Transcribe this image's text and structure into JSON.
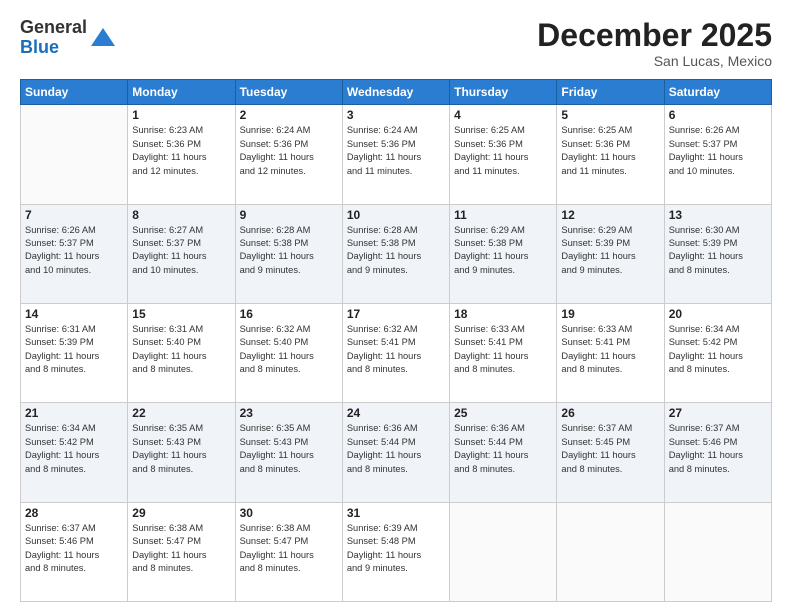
{
  "header": {
    "logo_general": "General",
    "logo_blue": "Blue",
    "month_title": "December 2025",
    "location": "San Lucas, Mexico"
  },
  "days_of_week": [
    "Sunday",
    "Monday",
    "Tuesday",
    "Wednesday",
    "Thursday",
    "Friday",
    "Saturday"
  ],
  "weeks": [
    [
      {
        "day": "",
        "info": ""
      },
      {
        "day": "1",
        "info": "Sunrise: 6:23 AM\nSunset: 5:36 PM\nDaylight: 11 hours\nand 12 minutes."
      },
      {
        "day": "2",
        "info": "Sunrise: 6:24 AM\nSunset: 5:36 PM\nDaylight: 11 hours\nand 12 minutes."
      },
      {
        "day": "3",
        "info": "Sunrise: 6:24 AM\nSunset: 5:36 PM\nDaylight: 11 hours\nand 11 minutes."
      },
      {
        "day": "4",
        "info": "Sunrise: 6:25 AM\nSunset: 5:36 PM\nDaylight: 11 hours\nand 11 minutes."
      },
      {
        "day": "5",
        "info": "Sunrise: 6:25 AM\nSunset: 5:36 PM\nDaylight: 11 hours\nand 11 minutes."
      },
      {
        "day": "6",
        "info": "Sunrise: 6:26 AM\nSunset: 5:37 PM\nDaylight: 11 hours\nand 10 minutes."
      }
    ],
    [
      {
        "day": "7",
        "info": "Sunrise: 6:26 AM\nSunset: 5:37 PM\nDaylight: 11 hours\nand 10 minutes."
      },
      {
        "day": "8",
        "info": "Sunrise: 6:27 AM\nSunset: 5:37 PM\nDaylight: 11 hours\nand 10 minutes."
      },
      {
        "day": "9",
        "info": "Sunrise: 6:28 AM\nSunset: 5:38 PM\nDaylight: 11 hours\nand 9 minutes."
      },
      {
        "day": "10",
        "info": "Sunrise: 6:28 AM\nSunset: 5:38 PM\nDaylight: 11 hours\nand 9 minutes."
      },
      {
        "day": "11",
        "info": "Sunrise: 6:29 AM\nSunset: 5:38 PM\nDaylight: 11 hours\nand 9 minutes."
      },
      {
        "day": "12",
        "info": "Sunrise: 6:29 AM\nSunset: 5:39 PM\nDaylight: 11 hours\nand 9 minutes."
      },
      {
        "day": "13",
        "info": "Sunrise: 6:30 AM\nSunset: 5:39 PM\nDaylight: 11 hours\nand 8 minutes."
      }
    ],
    [
      {
        "day": "14",
        "info": "Sunrise: 6:31 AM\nSunset: 5:39 PM\nDaylight: 11 hours\nand 8 minutes."
      },
      {
        "day": "15",
        "info": "Sunrise: 6:31 AM\nSunset: 5:40 PM\nDaylight: 11 hours\nand 8 minutes."
      },
      {
        "day": "16",
        "info": "Sunrise: 6:32 AM\nSunset: 5:40 PM\nDaylight: 11 hours\nand 8 minutes."
      },
      {
        "day": "17",
        "info": "Sunrise: 6:32 AM\nSunset: 5:41 PM\nDaylight: 11 hours\nand 8 minutes."
      },
      {
        "day": "18",
        "info": "Sunrise: 6:33 AM\nSunset: 5:41 PM\nDaylight: 11 hours\nand 8 minutes."
      },
      {
        "day": "19",
        "info": "Sunrise: 6:33 AM\nSunset: 5:41 PM\nDaylight: 11 hours\nand 8 minutes."
      },
      {
        "day": "20",
        "info": "Sunrise: 6:34 AM\nSunset: 5:42 PM\nDaylight: 11 hours\nand 8 minutes."
      }
    ],
    [
      {
        "day": "21",
        "info": "Sunrise: 6:34 AM\nSunset: 5:42 PM\nDaylight: 11 hours\nand 8 minutes."
      },
      {
        "day": "22",
        "info": "Sunrise: 6:35 AM\nSunset: 5:43 PM\nDaylight: 11 hours\nand 8 minutes."
      },
      {
        "day": "23",
        "info": "Sunrise: 6:35 AM\nSunset: 5:43 PM\nDaylight: 11 hours\nand 8 minutes."
      },
      {
        "day": "24",
        "info": "Sunrise: 6:36 AM\nSunset: 5:44 PM\nDaylight: 11 hours\nand 8 minutes."
      },
      {
        "day": "25",
        "info": "Sunrise: 6:36 AM\nSunset: 5:44 PM\nDaylight: 11 hours\nand 8 minutes."
      },
      {
        "day": "26",
        "info": "Sunrise: 6:37 AM\nSunset: 5:45 PM\nDaylight: 11 hours\nand 8 minutes."
      },
      {
        "day": "27",
        "info": "Sunrise: 6:37 AM\nSunset: 5:46 PM\nDaylight: 11 hours\nand 8 minutes."
      }
    ],
    [
      {
        "day": "28",
        "info": "Sunrise: 6:37 AM\nSunset: 5:46 PM\nDaylight: 11 hours\nand 8 minutes."
      },
      {
        "day": "29",
        "info": "Sunrise: 6:38 AM\nSunset: 5:47 PM\nDaylight: 11 hours\nand 8 minutes."
      },
      {
        "day": "30",
        "info": "Sunrise: 6:38 AM\nSunset: 5:47 PM\nDaylight: 11 hours\nand 8 minutes."
      },
      {
        "day": "31",
        "info": "Sunrise: 6:39 AM\nSunset: 5:48 PM\nDaylight: 11 hours\nand 9 minutes."
      },
      {
        "day": "",
        "info": ""
      },
      {
        "day": "",
        "info": ""
      },
      {
        "day": "",
        "info": ""
      }
    ]
  ]
}
